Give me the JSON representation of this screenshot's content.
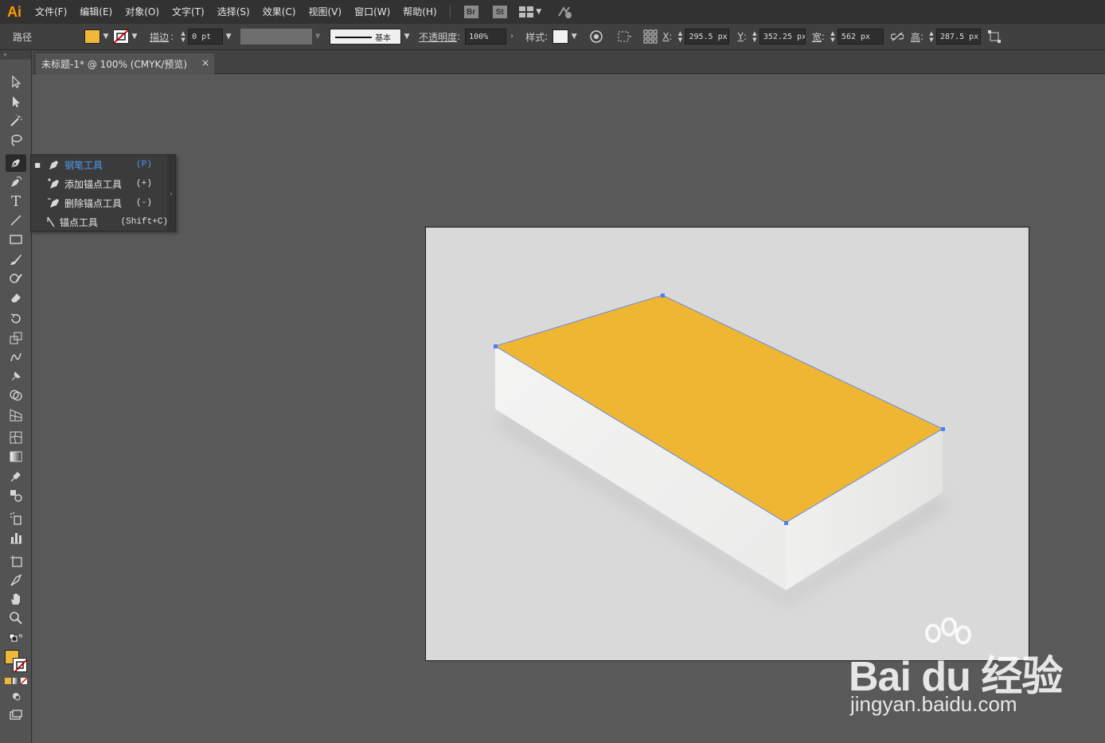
{
  "app": {
    "logo": "Ai"
  },
  "menu": [
    "文件(F)",
    "编辑(E)",
    "对象(O)",
    "文字(T)",
    "选择(S)",
    "效果(C)",
    "视图(V)",
    "窗口(W)",
    "帮助(H)"
  ],
  "app_buttons": {
    "bridge": "Br",
    "stock": "St"
  },
  "control": {
    "selection_label": "路径",
    "fill_color": "#f0b838",
    "stroke_label": "描边",
    "stroke_weight": "0 pt",
    "stroke_profile": "基本",
    "opacity_label": "不透明度",
    "opacity_value": "100%",
    "style_label": "样式",
    "x_label": "X",
    "x_value": "295.5 px",
    "y_label": "Y",
    "y_value": "352.25 px",
    "w_label": "宽",
    "w_value": "562 px",
    "h_label": "高",
    "h_value": "287.5 px"
  },
  "document_tab": {
    "title": "未标题-1* @ 100% (CMYK/预览)",
    "close": "×"
  },
  "flyout": [
    {
      "label": "钢笔工具",
      "shortcut": "(P)",
      "active": true
    },
    {
      "label": "添加锚点工具",
      "shortcut": "(+)",
      "active": false
    },
    {
      "label": "删除锚点工具",
      "shortcut": "(-)",
      "active": false
    },
    {
      "label": "锚点工具",
      "shortcut": "(Shift+C)",
      "active": false
    }
  ],
  "artwork": {
    "top_face_color": "#efb633",
    "side_face_color": "#ececeb",
    "front_face_color": "#f4f4f3",
    "anchor_color": "#4a7dff"
  },
  "watermark": {
    "brand": "Bai du 经验",
    "url": "jingyan.baidu.com"
  }
}
